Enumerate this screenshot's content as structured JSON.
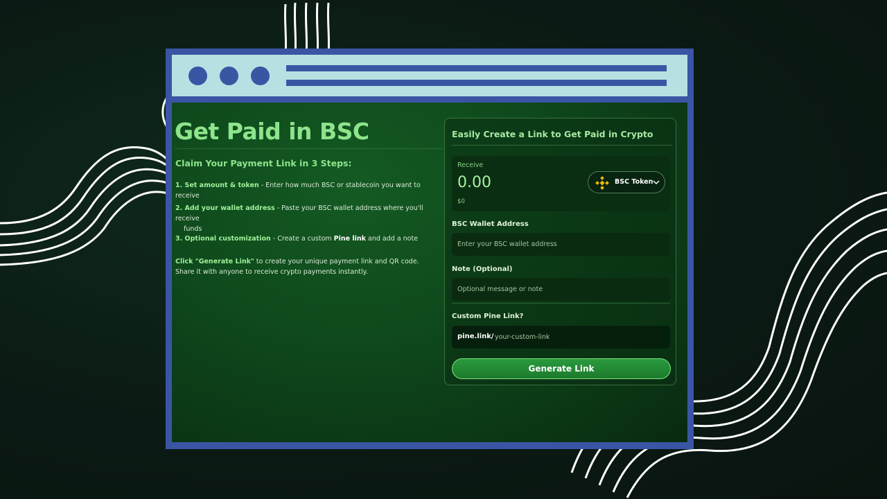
{
  "window": {
    "dots": [
      "window-dot",
      "window-dot",
      "window-dot"
    ]
  },
  "left": {
    "heading": "Get Paid in BSC",
    "steps_title": "Claim Your Payment Link in 3 Steps:",
    "steps": [
      {
        "title": "1. Set amount & token",
        "text": " - Enter how much BSC or stablecoin you want to receive"
      },
      {
        "title": "2. Add your wallet address",
        "text": " - Paste your BSC wallet address where you'll receive",
        "text2": "funds"
      },
      {
        "title": "3. Optional customization",
        "text_a": " - Create a custom ",
        "highlight": "Pine link",
        "text_b": " and add a note"
      }
    ],
    "cta_bold": "Click \"Generate Link\"",
    "cta_text": " to create your unique payment link and QR code. Share it with anyone to receive crypto payments instantly."
  },
  "card": {
    "title": "Easily Create a Link to Get Paid in Crypto",
    "receive_label": "Receive",
    "amount": "0.00",
    "usd_value": "$0",
    "token_label": "BSC Token",
    "token_icon": "bnb-icon",
    "wallet_label": "BSC Wallet Address",
    "wallet_placeholder": "Enter your BSC wallet address",
    "note_label": "Note (Optional)",
    "note_placeholder": "Optional message or note",
    "custom_label": "Custom Pine Link?",
    "link_prefix": "pine.link/",
    "link_placeholder": "your-custom-link",
    "generate_label": "Generate Link"
  },
  "colors": {
    "accent": "#8ee48c",
    "frame": "#3a55a4",
    "titlebar": "#b7e0e2",
    "bnb": "#f0b90b"
  }
}
